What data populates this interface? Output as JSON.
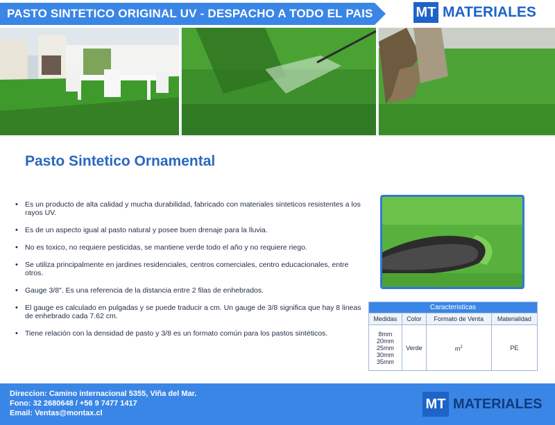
{
  "header": {
    "banner_text": "PASTO SINTETICO ORIGINAL UV - DESPACHO A TODO EL PAIS",
    "logo_mark": "MT",
    "logo_word": "MATERIALES"
  },
  "main": {
    "title": "Pasto Sintetico Ornamental",
    "bullets": [
      "Es un producto de alta calidad y mucha durabilidad, fabricado con materiales sinteticos resistentes a los rayos UV.",
      "Es de un aspecto igual al pasto natural y posee buen drenaje para la lluvia.",
      "No es toxico, no requiere pesticidas, se mantiene verde todo el año y no requiere riego.",
      "Se utiliza principalmente en jardines residenciales, centros comerciales, centro educacionales, entre otros.",
      "Gauge 3/8\". Es una referencia de la distancia entre 2 filas de enhebrados.",
      "El gauge es calculado en pulgadas y se puede traducir a cm. Un gauge de 3/8 significa que hay 8 lineas de enhebrado cada 7.62 cm.",
      "Tiene relación con la densidad de pasto y 3/8 es un formato común para los pastos sintéticos."
    ]
  },
  "specs": {
    "title": "Caracteristicas",
    "columns": [
      "Medidas",
      "Color",
      "Formato de Venta",
      "Materialidad"
    ],
    "medidas": [
      "8mm",
      "20mm",
      "25mm",
      "30mm",
      "35mm"
    ],
    "color": "Verde",
    "formato": "m",
    "formato_sup": "2",
    "materialidad": "PE"
  },
  "footer": {
    "address": "Direccion: Camino internacional 5355, Viña del Mar.",
    "phone": "Fono: 32 2680648 / +56 9 7477 1417",
    "email": "Email: Ventas@montax.cl",
    "logo_mark": "MT",
    "logo_word": "MATERIALES"
  },
  "colors": {
    "brand_blue": "#3a86e6",
    "logo_blue": "#1e63c8",
    "title_blue": "#2a67bf",
    "grass_green": "#3f9a2c"
  }
}
